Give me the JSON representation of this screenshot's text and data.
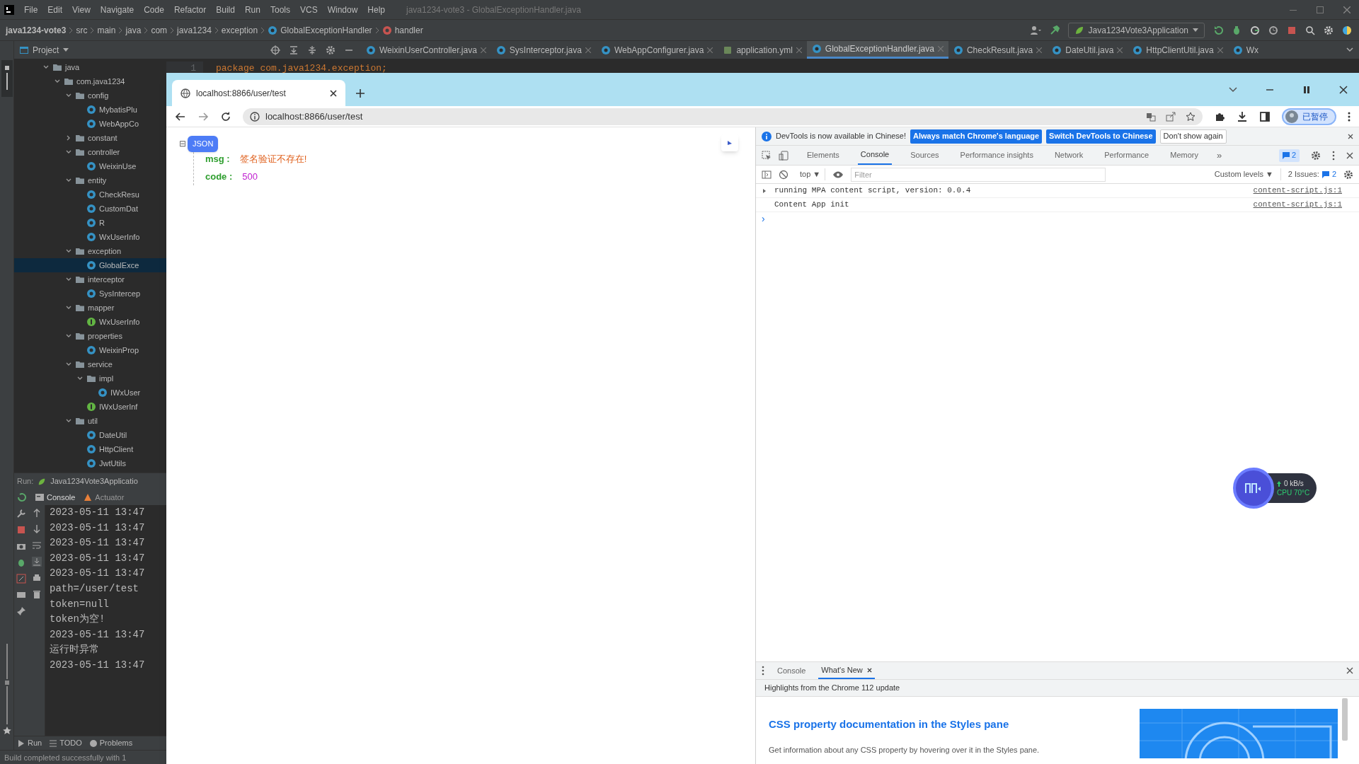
{
  "ide": {
    "title": "java1234-vote3 - GlobalExceptionHandler.java",
    "menu": [
      "File",
      "Edit",
      "View",
      "Navigate",
      "Code",
      "Refactor",
      "Build",
      "Run",
      "Tools",
      "VCS",
      "Window",
      "Help"
    ],
    "breadcrumb": [
      {
        "label": "java1234-vote3",
        "kind": "project"
      },
      {
        "label": "src",
        "kind": "dir"
      },
      {
        "label": "main",
        "kind": "dir"
      },
      {
        "label": "java",
        "kind": "dir"
      },
      {
        "label": "com",
        "kind": "dir"
      },
      {
        "label": "java1234",
        "kind": "dir"
      },
      {
        "label": "exception",
        "kind": "dir"
      },
      {
        "label": "GlobalExceptionHandler",
        "kind": "class"
      },
      {
        "label": "handler",
        "kind": "method"
      }
    ],
    "run_config": "Java1234Vote3Application",
    "project_title": "Project",
    "editor_tabs": [
      {
        "label": "WeixinUserController.java",
        "kind": "class",
        "selected": false
      },
      {
        "label": "SysInterceptor.java",
        "kind": "class",
        "selected": false
      },
      {
        "label": "WebAppConfigurer.java",
        "kind": "class",
        "selected": false
      },
      {
        "label": "application.yml",
        "kind": "yaml",
        "selected": false
      },
      {
        "label": "GlobalExceptionHandler.java",
        "kind": "class",
        "selected": true
      },
      {
        "label": "CheckResult.java",
        "kind": "class",
        "selected": false
      },
      {
        "label": "DateUtil.java",
        "kind": "class",
        "selected": false
      },
      {
        "label": "HttpClientUtil.java",
        "kind": "class",
        "selected": false
      },
      {
        "label": "Wx",
        "kind": "class",
        "selected": false
      }
    ],
    "code_line": {
      "number": "1",
      "text": "package com.java1234.exception;"
    },
    "tree": [
      {
        "label": "java",
        "kind": "folder",
        "expanded": true,
        "selected": false,
        "children": [
          {
            "label": "com.java1234",
            "kind": "folder",
            "expanded": true,
            "selected": false,
            "children": [
              {
                "label": "config",
                "kind": "folder",
                "expanded": true,
                "selected": false,
                "children": [
                  {
                    "label": "MybatisPlu",
                    "kind": "class",
                    "selected": false
                  },
                  {
                    "label": "WebAppCo",
                    "kind": "class",
                    "selected": false
                  }
                ]
              },
              {
                "label": "constant",
                "kind": "folder",
                "expanded": false,
                "selected": false
              },
              {
                "label": "controller",
                "kind": "folder",
                "expanded": true,
                "selected": false,
                "children": [
                  {
                    "label": "WeixinUse",
                    "kind": "class",
                    "selected": false
                  }
                ]
              },
              {
                "label": "entity",
                "kind": "folder",
                "expanded": true,
                "selected": false,
                "children": [
                  {
                    "label": "CheckResu",
                    "kind": "class",
                    "selected": false
                  },
                  {
                    "label": "CustomDat",
                    "kind": "class",
                    "selected": false
                  },
                  {
                    "label": "R",
                    "kind": "class",
                    "selected": false
                  },
                  {
                    "label": "WxUserInfo",
                    "kind": "class",
                    "selected": false
                  }
                ]
              },
              {
                "label": "exception",
                "kind": "folder",
                "expanded": true,
                "selected": false,
                "children": [
                  {
                    "label": "GlobalExce",
                    "kind": "class",
                    "selected": true
                  }
                ]
              },
              {
                "label": "interceptor",
                "kind": "folder",
                "expanded": true,
                "selected": false,
                "children": [
                  {
                    "label": "SysIntercep",
                    "kind": "class",
                    "selected": false
                  }
                ]
              },
              {
                "label": "mapper",
                "kind": "folder",
                "expanded": true,
                "selected": false,
                "children": [
                  {
                    "label": "WxUserInfo",
                    "kind": "interface",
                    "selected": false
                  }
                ]
              },
              {
                "label": "properties",
                "kind": "folder",
                "expanded": true,
                "selected": false,
                "children": [
                  {
                    "label": "WeixinProp",
                    "kind": "class",
                    "selected": false
                  }
                ]
              },
              {
                "label": "service",
                "kind": "folder",
                "expanded": true,
                "selected": false,
                "children": [
                  {
                    "label": "impl",
                    "kind": "folder",
                    "expanded": true,
                    "selected": false,
                    "children": [
                      {
                        "label": "IWxUser",
                        "kind": "class",
                        "selected": false
                      }
                    ]
                  },
                  {
                    "label": "IWxUserInf",
                    "kind": "interface",
                    "selected": false
                  }
                ]
              },
              {
                "label": "util",
                "kind": "folder",
                "expanded": true,
                "selected": false,
                "children": [
                  {
                    "label": "DateUtil",
                    "kind": "class",
                    "selected": false
                  },
                  {
                    "label": "HttpClient",
                    "kind": "class",
                    "selected": false
                  },
                  {
                    "label": "JwtUtils",
                    "kind": "class",
                    "selected": false
                  }
                ]
              }
            ]
          }
        ]
      }
    ],
    "run_panel": {
      "label": "Run:",
      "config": "Java1234Vote3Applicatio",
      "tabs": [
        {
          "label": "Console",
          "kind": "console",
          "selected": true
        },
        {
          "label": "Actuator",
          "kind": "actuator",
          "selected": false
        }
      ],
      "lines": [
        "2023-05-11 13:47",
        "2023-05-11 13:47",
        "2023-05-11 13:47",
        "2023-05-11 13:47",
        "2023-05-11 13:47",
        "path=/user/test",
        "token=null",
        "token为空!",
        "2023-05-11 13:47",
        "运行时异常",
        "2023-05-11 13:47"
      ]
    },
    "bottom_tabs": [
      {
        "label": "Run",
        "kind": "run"
      },
      {
        "label": "TODO",
        "kind": "todo"
      },
      {
        "label": "Problems",
        "kind": "problems"
      }
    ],
    "status": "Build completed successfully with 1"
  },
  "browser": {
    "tab_title": "localhost:8866/user/test",
    "address": "localhost:8866/user/test",
    "profile": "已暂停",
    "json_viewer": {
      "toggle": "⊟",
      "badge": "JSON",
      "fields": [
        {
          "key": "msg :",
          "value": "签名验证不存在!",
          "kind": "string"
        },
        {
          "key": "code :",
          "value": "500",
          "kind": "number"
        }
      ]
    }
  },
  "devtools": {
    "info": "DevTools is now available in Chinese!",
    "info_buttons": [
      {
        "label": "Always match Chrome's language",
        "kind": "primary"
      },
      {
        "label": "Switch DevTools to Chinese",
        "kind": "primary"
      },
      {
        "label": "Don't show again",
        "kind": "plain"
      }
    ],
    "tabs": [
      {
        "label": "Elements",
        "selected": false
      },
      {
        "label": "Console",
        "selected": true
      },
      {
        "label": "Sources",
        "selected": false
      },
      {
        "label": "Performance insights",
        "selected": false
      },
      {
        "label": "Network",
        "selected": false
      },
      {
        "label": "Performance",
        "selected": false
      },
      {
        "label": "Memory",
        "selected": false
      }
    ],
    "more": "»",
    "message_count": "2",
    "context": "top ▼",
    "filter_placeholder": "Filter",
    "levels": "Custom levels ▼",
    "issues_label": "2 Issues:",
    "issues_count": "2",
    "logs": [
      {
        "text": "running MPA content script, version: 0.0.4",
        "source": "content-script.js:1",
        "kind": "group"
      },
      {
        "text": "Content App init",
        "source": "content-script.js:1",
        "kind": "plain"
      }
    ],
    "prompt": "›",
    "drawer_tabs": [
      {
        "label": "Console",
        "selected": false
      },
      {
        "label": "What's New",
        "selected": true
      }
    ],
    "highlights": "Highlights from the Chrome 112 update",
    "article_title": "CSS property documentation in the Styles pane",
    "article_text": "Get information about any CSS property by hovering over it in the Styles pane."
  },
  "monitor": {
    "speed": "0 kB/s",
    "cpu": "CPU 70°C"
  }
}
